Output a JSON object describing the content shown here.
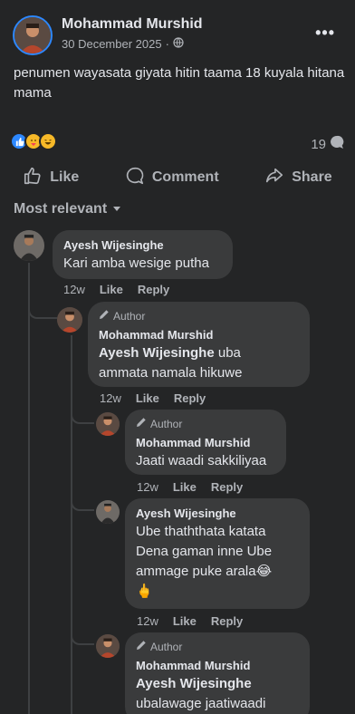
{
  "post": {
    "author": "Mohammad Murshid",
    "date": "30 December 2025",
    "privacy_separator": "·",
    "text": "penumen wayasata giyata hitin taama 18 kuyala hitana mama",
    "comment_count": "19",
    "more_label": "•••"
  },
  "actions": {
    "like": "Like",
    "comment": "Comment",
    "share": "Share"
  },
  "sort_label": "Most relevant",
  "comments": [
    {
      "name": "Ayesh Wijesinghe",
      "text": "Kari amba wesige putha",
      "time": "12w",
      "like": "Like",
      "reply": "Reply"
    },
    {
      "badge": "Author",
      "name": "Mohammad Murshid",
      "mention": "Ayesh Wijesinghe",
      "text_line1": " uba",
      "text_line2": "ammata namala hikuwe",
      "time": "12w",
      "like": "Like",
      "reply": "Reply"
    },
    {
      "badge": "Author",
      "name": "Mohammad Murshid",
      "text": "Jaati waadi sakkiliyaa",
      "time": "12w",
      "like": "Like",
      "reply": "Reply"
    },
    {
      "name": "Ayesh Wijesinghe",
      "line1": "Ube thaththata katata",
      "line2": "Dena gaman inne Ube",
      "line3": "ammage puke arala😂",
      "line4": "🖕",
      "time": "12w",
      "like": "Like",
      "reply": "Reply"
    },
    {
      "badge": "Author",
      "name": "Mohammad Murshid",
      "mention": "Ayesh Wijesinghe",
      "text": "ubalawage jaatiwaadi"
    }
  ],
  "colors": {
    "accent": "#2d88ff",
    "background": "#242526",
    "bubble": "#3a3b3c",
    "muted": "#b0b3b8"
  }
}
